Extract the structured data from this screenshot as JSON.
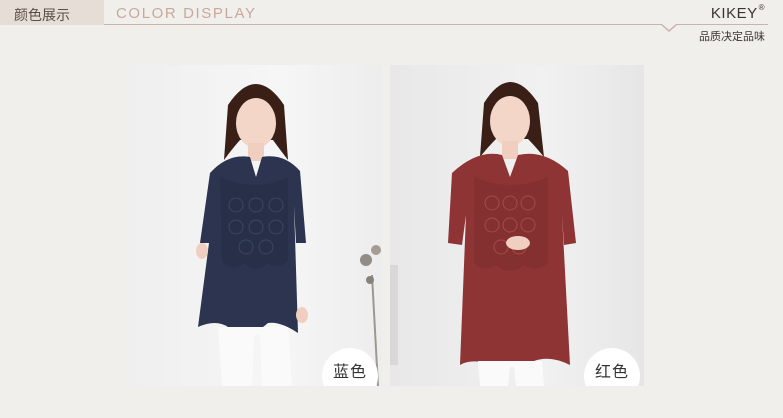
{
  "header": {
    "title_cn": "颜色展示",
    "title_en": "COLOR DISPLAY",
    "brand": "KIKEY",
    "brand_mark": "®",
    "slogan": "品质决定品味"
  },
  "products": [
    {
      "label": "蓝色",
      "icon": "model-navy-blouse-icon",
      "garment_color": "#2c3450"
    },
    {
      "label": "红色",
      "icon": "model-red-blouse-icon",
      "garment_color": "#8f3434"
    }
  ],
  "colors": {
    "background": "#f1efeb",
    "accent_line": "#c8b4a8",
    "title_en": "#c7a99b"
  }
}
